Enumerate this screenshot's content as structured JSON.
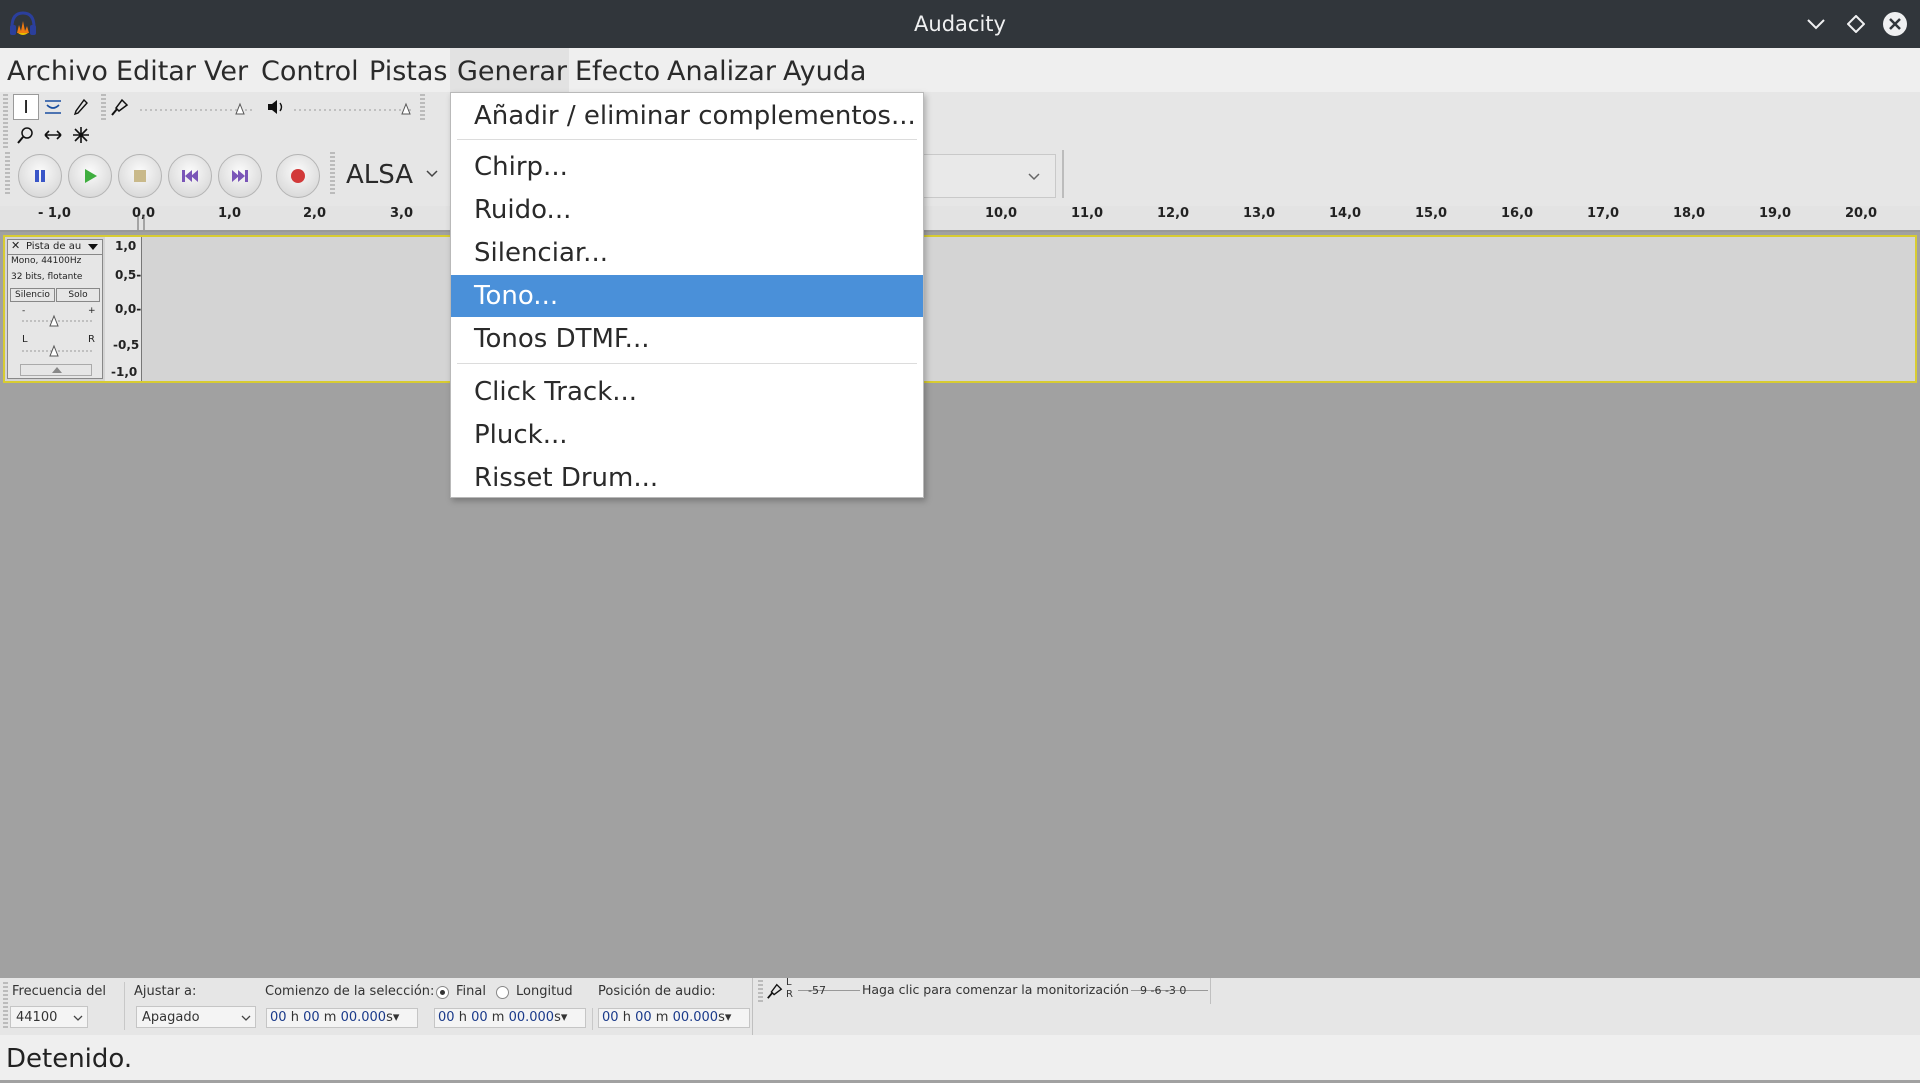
{
  "window": {
    "title": "Audacity",
    "app_icon": "audacity-headphones-logo"
  },
  "menubar": {
    "items": [
      {
        "label": "Archivo"
      },
      {
        "label": "Editar"
      },
      {
        "label": "Ver"
      },
      {
        "label": "Control"
      },
      {
        "label": "Pistas"
      },
      {
        "label": "Generar",
        "open": true
      },
      {
        "label": "Efecto"
      },
      {
        "label": "Analizar"
      },
      {
        "label": "Ayuda"
      }
    ]
  },
  "generate_menu": {
    "items": [
      {
        "label": "Añadir / eliminar complementos..."
      },
      {
        "label": "Chirp..."
      },
      {
        "label": "Ruido..."
      },
      {
        "label": "Silenciar..."
      },
      {
        "label": "Tono...",
        "highlighted": true
      },
      {
        "label": "Tonos DTMF..."
      },
      {
        "label": "Click Track..."
      },
      {
        "label": "Pluck..."
      },
      {
        "label": "Risset Drum..."
      }
    ]
  },
  "device_toolbar": {
    "host": "ALSA"
  },
  "ruler": {
    "ticks": [
      "- 1,0",
      "0,0",
      "1,0",
      "2,0",
      "3,0",
      "10,0",
      "11,0",
      "12,0",
      "13,0",
      "14,0",
      "15,0",
      "16,0",
      "17,0",
      "18,0",
      "19,0",
      "20,0"
    ]
  },
  "track": {
    "name": "Pista de au",
    "info_line1": "Mono, 44100Hz",
    "info_line2": "32 bits, flotante",
    "mute_label": "Silencio",
    "solo_label": "Solo",
    "gain_minus": "-",
    "gain_plus": "+",
    "pan_left": "L",
    "pan_right": "R",
    "scale": [
      "1,0",
      "0,5-",
      "0,0-",
      "-0,5",
      "-1,0"
    ]
  },
  "selection_toolbar": {
    "rate_label": "Frecuencia del",
    "rate_value": "44100",
    "snap_label": "Ajustar a:",
    "snap_value": "Apagado",
    "start_label": "Comienzo de la selección:",
    "end_label": "Final",
    "length_label": "Longitud",
    "position_label": "Posición de audio:",
    "time_h": "00",
    "time_m": "00",
    "time_s": "00.000",
    "unit_h": "h",
    "unit_m": "m",
    "unit_s": "s",
    "end_selected": true
  },
  "meter": {
    "lr_top": "L",
    "lr_bottom": "R",
    "left_value": "-57",
    "hint": "Haga clic para comenzar la monitorización",
    "right_values": "9 -6 -3 0"
  },
  "status": {
    "text": "Detenido."
  }
}
